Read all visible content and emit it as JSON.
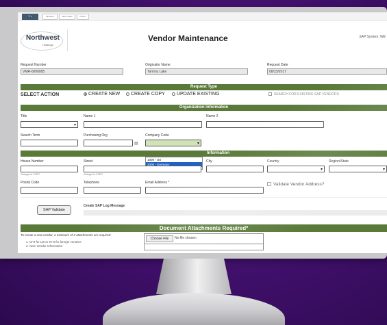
{
  "topbar": {
    "buttons": [
      "SEARCH",
      "NEW VIEW",
      "PRINT"
    ]
  },
  "logo": {
    "name": "Northwest",
    "sub": "Holdings"
  },
  "header": {
    "title": "Vendor Maintenance",
    "sap_system": "SAP System: WE"
  },
  "request": {
    "number_label": "Request Number",
    "number_value": "VMR-0000085",
    "originator_label": "Originator Name",
    "originator_value": "Tammy Lake",
    "date_label": "Request Date",
    "date_value": "08/23/2017"
  },
  "request_type": {
    "bar": "Request Type",
    "select_action": "SELECT ACTION",
    "options": [
      "CREATE NEW",
      "CREATE COPY",
      "UPDATE EXISTING"
    ],
    "search_existing": "SEARCH FOR EXISTING SAP VENDORS"
  },
  "org_info": {
    "bar": "Organization Information",
    "title_label": "Title",
    "name1_label": "Name 1",
    "name2_label": "Name 2",
    "search_term_label": "Search Term",
    "purchasing_org_label": "Purchasing Org",
    "company_code_label": "Company Code",
    "company_code_options": [
      "1000 - US",
      "3000 - Germany"
    ]
  },
  "address_info": {
    "bar_partial": "Information",
    "house_label": "House Number",
    "street_label": "Street",
    "city_label": "City",
    "country_label": "Country",
    "region_label": "Region/State",
    "change_for_copy": "Change for COPY",
    "postal_label": "Postal Code",
    "telephone_label": "Telephone",
    "email_label": "Email Address *",
    "validate_label": "Validate Vendor Address?"
  },
  "sap": {
    "validate_button": "SAP Validate",
    "log_label": "Create SAP Log Message"
  },
  "attachments": {
    "bar": "Document Attachments Required*",
    "note": "To create a new vendor, a minimum of 2 attachments are required:",
    "item1": "1.  W-9 for US or W-8 for foreign vendors",
    "item2": "2.  New Vendor Information",
    "choose_file": "Choose File",
    "no_file": "No file chosen"
  }
}
